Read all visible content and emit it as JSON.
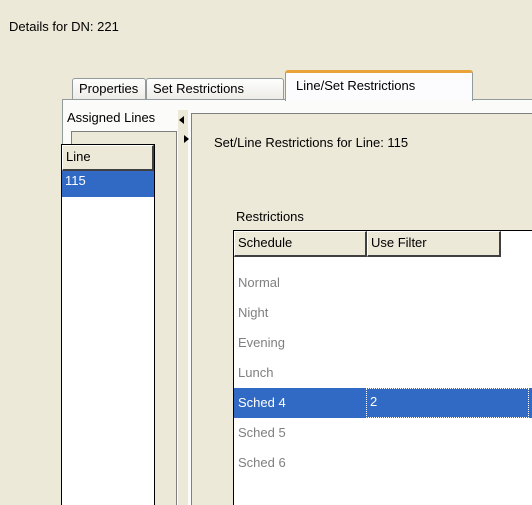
{
  "window": {
    "title": "Details for DN: 221"
  },
  "tabs": [
    {
      "label": "Properties"
    },
    {
      "label": "Set Restrictions"
    },
    {
      "label": "Line/Set Restrictions"
    }
  ],
  "assigned_lines": {
    "label": "Assigned Lines",
    "column_header": "Line",
    "rows": [
      "115"
    ]
  },
  "restrictions_panel": {
    "title": "Set/Line Restrictions for Line: 115",
    "group_label": "Restrictions",
    "columns": [
      "Schedule",
      "Use Filter"
    ],
    "rows": [
      {
        "schedule": "Normal",
        "use_filter": ""
      },
      {
        "schedule": "Night",
        "use_filter": ""
      },
      {
        "schedule": "Evening",
        "use_filter": ""
      },
      {
        "schedule": "Lunch",
        "use_filter": ""
      },
      {
        "schedule": "Sched 4",
        "use_filter": "2"
      },
      {
        "schedule": "Sched 5",
        "use_filter": ""
      },
      {
        "schedule": "Sched 6",
        "use_filter": ""
      }
    ],
    "selected_row": 4
  },
  "colors": {
    "selection": "#316ac5",
    "active_tab_accent": "#e8a33a",
    "disabled_text": "#7f7f7f"
  }
}
